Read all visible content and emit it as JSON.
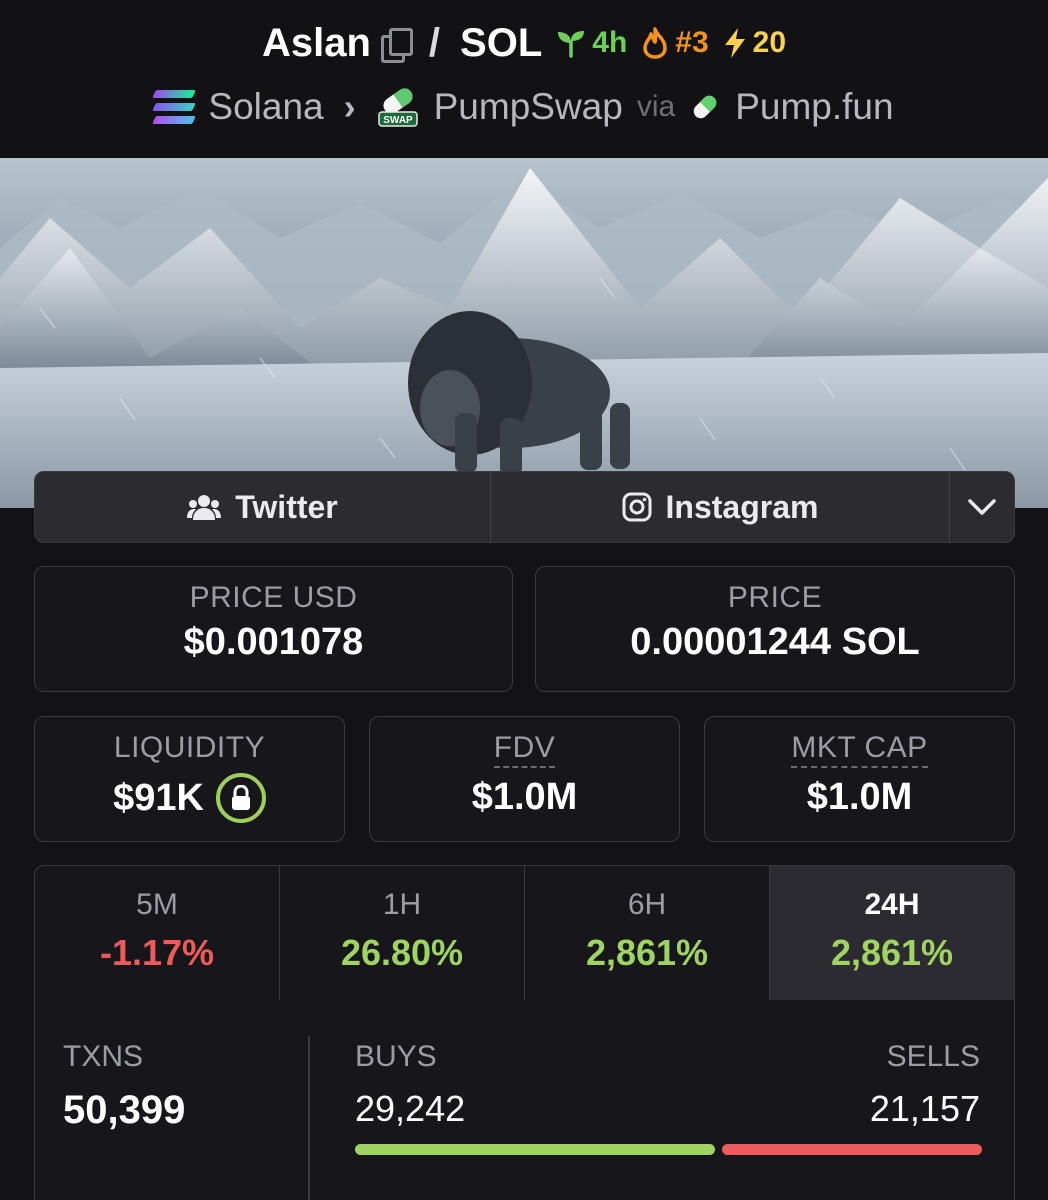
{
  "header": {
    "base_token": "Aslan",
    "separator": "/",
    "quote_token": "SOL",
    "age_badge": "4h",
    "rank_badge": "#3",
    "boost_badge": "20",
    "chain": "Solana",
    "dex": "PumpSwap",
    "via_label": "via",
    "launchpad": "Pump.fun",
    "dex_logo_text": "SWAP"
  },
  "socials": {
    "twitter_label": "Twitter",
    "instagram_label": "Instagram"
  },
  "price": {
    "usd_label": "PRICE USD",
    "usd_value": "$0.001078",
    "native_label": "PRICE",
    "native_value": "0.00001244 SOL"
  },
  "stats": {
    "liquidity_label": "LIQUIDITY",
    "liquidity_value": "$91K",
    "fdv_label": "FDV",
    "fdv_value": "$1.0M",
    "mcap_label": "MKT CAP",
    "mcap_value": "$1.0M"
  },
  "periods": [
    {
      "label": "5M",
      "value": "-1.17%",
      "trend": "negative"
    },
    {
      "label": "1H",
      "value": "26.80%",
      "trend": "positive"
    },
    {
      "label": "6H",
      "value": "2,861%",
      "trend": "positive"
    },
    {
      "label": "24H",
      "value": "2,861%",
      "trend": "positive",
      "active": true
    }
  ],
  "txns": {
    "label": "TXNS",
    "total": "50,399",
    "buys_label": "BUYS",
    "buys": "29,242",
    "sells_label": "SELLS",
    "sells": "21,157",
    "buys_share": 0.58
  },
  "colors": {
    "positive": "#9fd462",
    "negative": "#ef5a5a",
    "age": "#6fce5a",
    "rank": "#f7931a",
    "boost": "#ffd24a"
  }
}
